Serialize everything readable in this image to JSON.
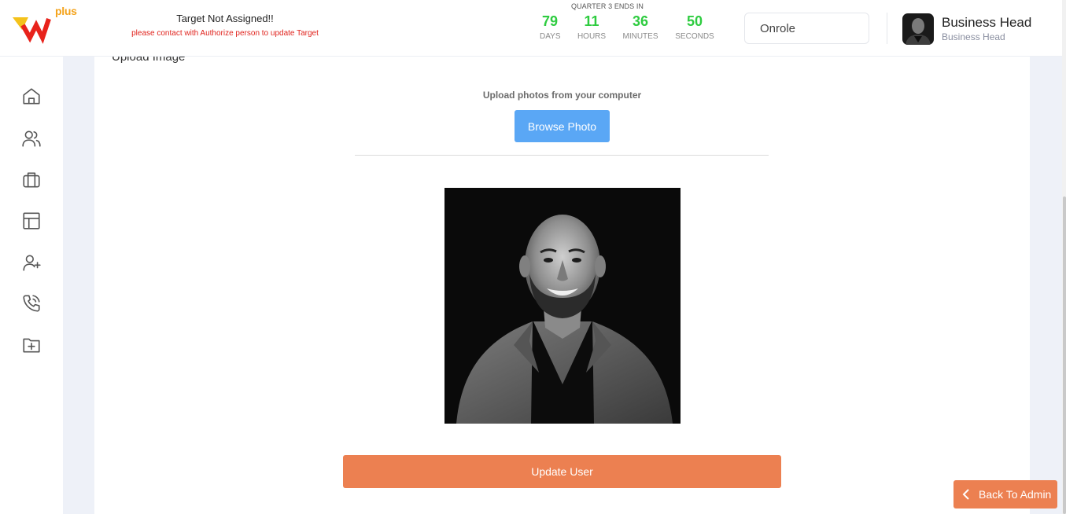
{
  "header": {
    "logo": {
      "badge": "plus",
      "icon": "wn-logo-icon"
    },
    "target": {
      "title": "Target Not Assigned!!",
      "message": "please contact with Authorize person to update Target"
    },
    "countdown": {
      "title": "QUARTER 3 ENDS IN",
      "units": [
        {
          "value": "79",
          "label": "DAYS"
        },
        {
          "value": "11",
          "label": "HOURS"
        },
        {
          "value": "36",
          "label": "MINUTES"
        },
        {
          "value": "50",
          "label": "SECONDS"
        }
      ]
    },
    "role_field": {
      "value": "Onrole",
      "placeholder": "Onrole"
    },
    "user": {
      "name": "Business Head",
      "role": "Business Head"
    }
  },
  "sidebar": {
    "items": [
      {
        "icon": "home-icon"
      },
      {
        "icon": "users-icon"
      },
      {
        "icon": "briefcase-icon"
      },
      {
        "icon": "layout-icon"
      },
      {
        "icon": "user-plus-icon"
      },
      {
        "icon": "phone-call-icon"
      },
      {
        "icon": "folder-plus-icon"
      }
    ]
  },
  "main": {
    "section_title": "Upload Image",
    "upload_text": "Upload photos from your computer",
    "browse_label": "Browse Photo",
    "update_label": "Update User"
  },
  "footer": {
    "back_label": "Back To Admin"
  },
  "colors": {
    "accent_orange": "#ec8051",
    "browse_blue": "#5aa7f5",
    "countdown_green": "#2ecc40",
    "warning_red": "#e0231d",
    "logo_yellow": "#f4c21b",
    "logo_red": "#e8221b"
  }
}
